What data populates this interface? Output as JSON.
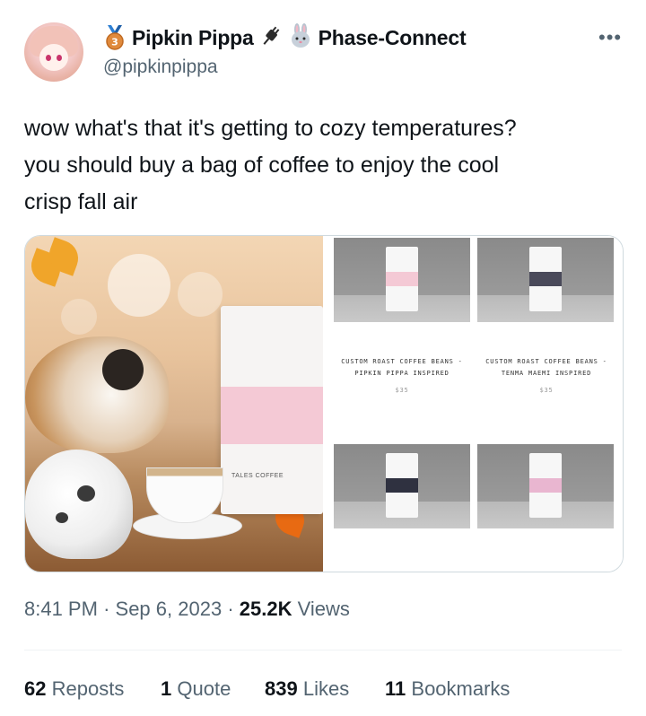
{
  "author": {
    "display_name": "Pipkin Pippa",
    "affiliation": "Phase-Connect",
    "handle": "@pipkinpippa",
    "medal_number": "3",
    "icons": [
      "medal-icon",
      "plug-icon",
      "rabbit-emoji-icon"
    ]
  },
  "more_label": "•••",
  "tweet": {
    "text": "wow what's that it's getting to cozy temperatures?\nyou should buy a bag of coffee to enjoy the cool\ncrisp fall air"
  },
  "media": {
    "left_photo": {
      "bag_brand": "TALES COFFEE"
    },
    "products": [
      {
        "title": "CUSTOM ROAST COFFEE BEANS -\nPIPKIN PIPPA INSPIRED",
        "price": "$35",
        "label_color": "#f4c9d5"
      },
      {
        "title": "CUSTOM ROAST COFFEE BEANS -\nTENMA MAEMI INSPIRED",
        "price": "$35",
        "label_color": "#4a4a5a"
      },
      {
        "title": "",
        "price": "",
        "label_color": "#2f3140"
      },
      {
        "title": "",
        "price": "",
        "label_color": "#e9b6d0"
      }
    ]
  },
  "meta": {
    "time": "8:41 PM",
    "separator": "·",
    "date": "Sep 6, 2023",
    "views_count": "25.2K",
    "views_label": "Views"
  },
  "stats": {
    "reposts_count": "62",
    "reposts_label": "Reposts",
    "quotes_count": "1",
    "quotes_label": "Quote",
    "likes_count": "839",
    "likes_label": "Likes",
    "bookmarks_count": "11",
    "bookmarks_label": "Bookmarks"
  },
  "colors": {
    "text_primary": "#0f1419",
    "text_secondary": "#536471",
    "border": "#cfd9de"
  }
}
